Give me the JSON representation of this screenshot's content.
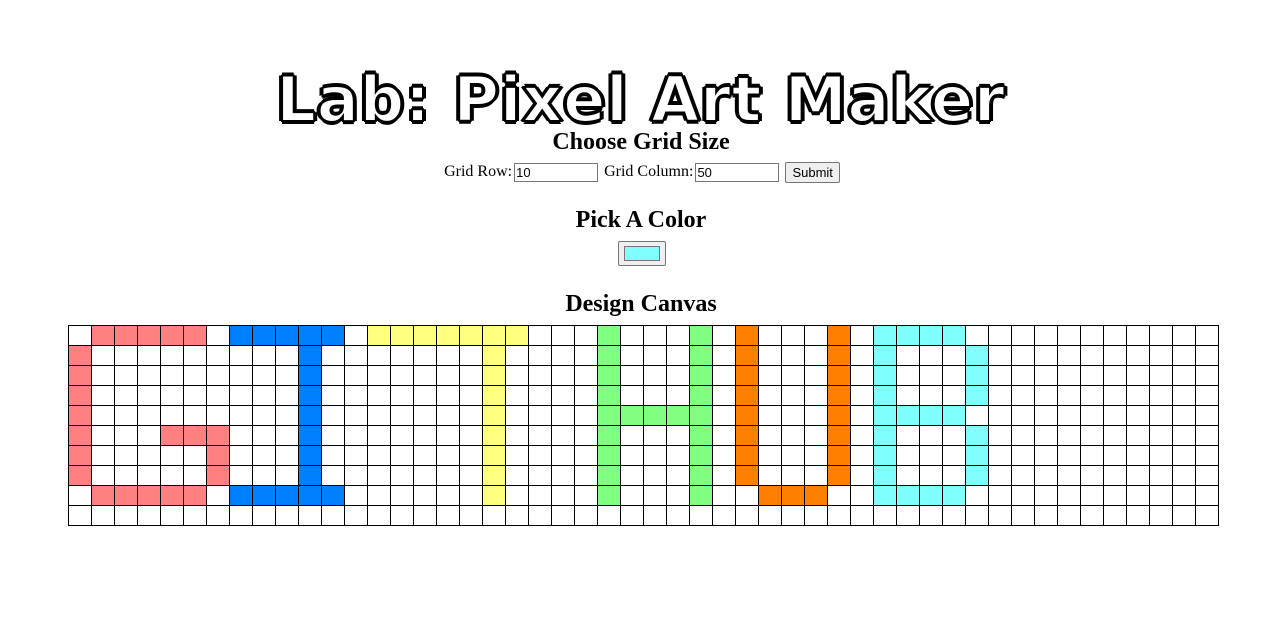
{
  "title": "Lab: Pixel Art Maker",
  "grid_size": {
    "heading": "Choose Grid Size",
    "row_label": "Grid Row:",
    "row_value": "10",
    "column_label": "Grid Column:",
    "column_value": "50",
    "submit_label": "Submit"
  },
  "color": {
    "heading": "Pick A Color",
    "value": "#80ffff"
  },
  "canvas": {
    "heading": "Design Canvas",
    "rows": 10,
    "columns": 50,
    "palette": {
      "R": "#ff8080",
      "B": "#0080ff",
      "Y": "#ffff80",
      "G": "#80ff80",
      "O": "#ff8000",
      "C": "#80ffff"
    },
    "pixels": [
      ".RRRRR.BBBBB.YYYYYYY...G...G.O...O.CCCC.............",
      "R.........B.......Y....G...G.O...O.C...C............",
      "R.........B.......Y....G...G.O...O.C...C............",
      "R.........B.......Y....G...G.O...O.C...C............",
      "R.........B.......Y....GGGGG.O...O.CCCC.............",
      "R...RRR...B.......Y....G...G.O...O.C...C............",
      "R.....R...B.......Y....G...G.O...O.C...C............",
      "R.....R...B.......Y....G...G.O...O.C...C............",
      ".RRRRR.BBBBB......Y....G...G..OOO..CCCC.............",
      ".................................................."
    ]
  }
}
